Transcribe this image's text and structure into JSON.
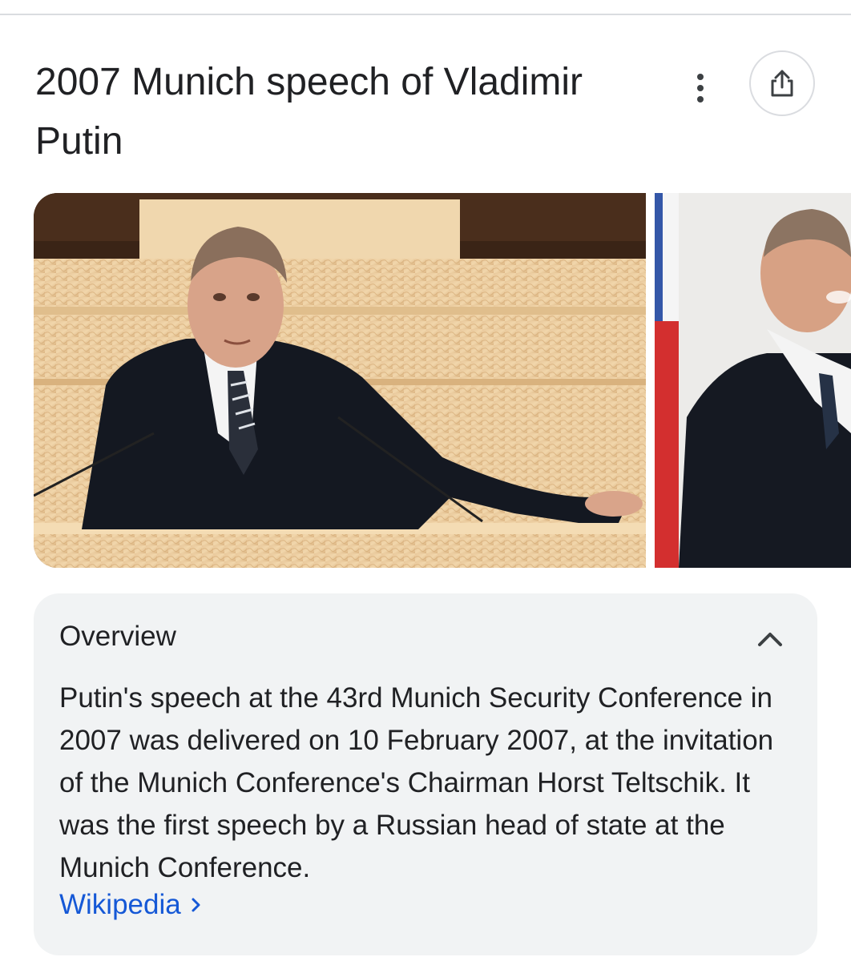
{
  "header": {
    "title": "2007 Munich speech of Vladimir Putin"
  },
  "actions": {
    "more_icon": "more-vert-icon",
    "share_icon": "share-icon"
  },
  "images": [
    {
      "alt": "Vladimir Putin speaking at a lectern"
    },
    {
      "alt": "Vladimir Putin smiling in front of a flag"
    }
  ],
  "overview": {
    "heading": "Overview",
    "collapse_icon": "chevron-up-icon",
    "text": "Putin's speech at the 43rd Munich Security Conference in 2007 was delivered on 10 February 2007, at the invitation of the Munich Conference's Chairman Horst Teltschik. It was the first speech by a Russian head of state at the Munich Conference.",
    "source_label": "Wikipedia",
    "source_icon": "chevron-right-icon"
  },
  "colors": {
    "link": "#1558d6",
    "card_bg": "#f1f3f4",
    "text": "#202124"
  }
}
